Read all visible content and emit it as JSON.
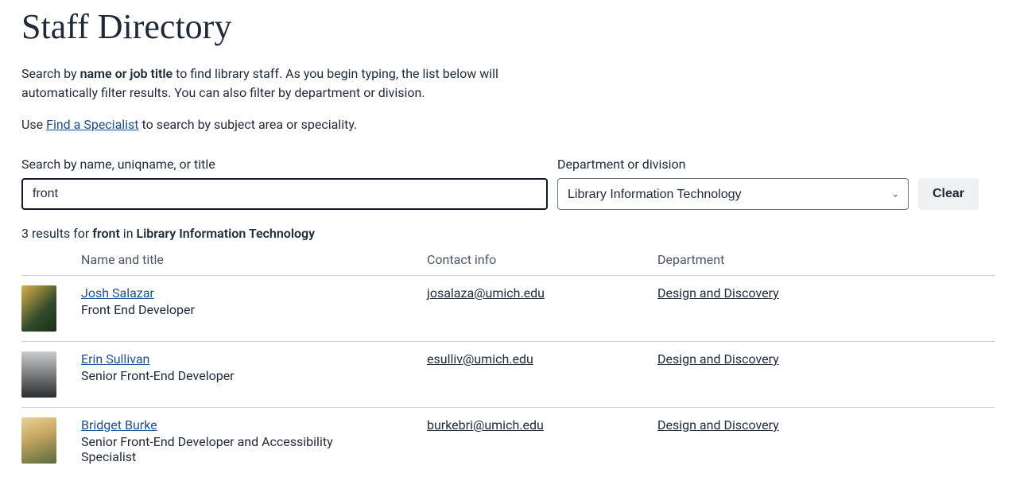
{
  "page": {
    "title": "Staff Directory"
  },
  "intro": {
    "part1_prefix": "Search by ",
    "part1_bold": "name or job title",
    "part1_suffix": " to find library staff. As you begin typing, the list below will automatically filter results. You can also filter by department or division.",
    "part2_prefix": "Use ",
    "specialist_link": "Find a Specialist",
    "part2_suffix": " to search by subject area or speciality."
  },
  "controls": {
    "search_label": "Search by name, uniqname, or title",
    "search_value": "front",
    "dept_label": "Department or division",
    "dept_value": "Library Information Technology",
    "clear_label": "Clear"
  },
  "summary": {
    "count_text": "3 results for ",
    "term": "front",
    "in_text": " in ",
    "dept": "Library Information Technology"
  },
  "columns": {
    "name": "Name and title",
    "contact": "Contact info",
    "dept": "Department"
  },
  "results": [
    {
      "name": "Josh Salazar",
      "title": "Front End Developer",
      "email": "josalaza@umich.edu",
      "department": "Design and Discovery",
      "avatar_bg": "linear-gradient(135deg, #d9b04a 0%, #2f4a2a 60%, #1a2e18 100%)"
    },
    {
      "name": "Erin Sullivan",
      "title": "Senior Front-End Developer",
      "email": "esulliv@umich.edu",
      "department": "Design and Discovery",
      "avatar_bg": "linear-gradient(180deg, #c9cbcd 0%, #5a5c5e 70%, #2b2c2d 100%)"
    },
    {
      "name": "Bridget Burke",
      "title": "Senior Front-End Developer and Accessibility Specialist",
      "email": "burkebri@umich.edu",
      "department": "Design and Discovery",
      "avatar_bg": "linear-gradient(160deg, #e8d29a 0%, #c9a863 40%, #5a6a3f 100%)"
    }
  ]
}
